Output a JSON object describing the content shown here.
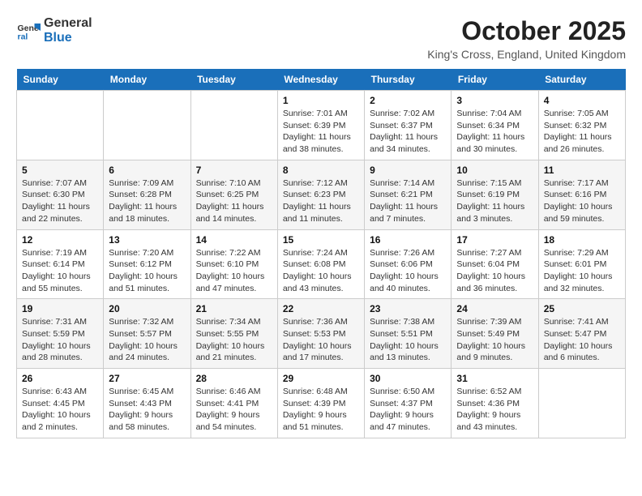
{
  "logo": {
    "line1": "General",
    "line2": "Blue"
  },
  "title": "October 2025",
  "location": "King's Cross, England, United Kingdom",
  "days_of_week": [
    "Sunday",
    "Monday",
    "Tuesday",
    "Wednesday",
    "Thursday",
    "Friday",
    "Saturday"
  ],
  "weeks": [
    [
      {
        "day": "",
        "detail": ""
      },
      {
        "day": "",
        "detail": ""
      },
      {
        "day": "",
        "detail": ""
      },
      {
        "day": "1",
        "detail": "Sunrise: 7:01 AM\nSunset: 6:39 PM\nDaylight: 11 hours\nand 38 minutes."
      },
      {
        "day": "2",
        "detail": "Sunrise: 7:02 AM\nSunset: 6:37 PM\nDaylight: 11 hours\nand 34 minutes."
      },
      {
        "day": "3",
        "detail": "Sunrise: 7:04 AM\nSunset: 6:34 PM\nDaylight: 11 hours\nand 30 minutes."
      },
      {
        "day": "4",
        "detail": "Sunrise: 7:05 AM\nSunset: 6:32 PM\nDaylight: 11 hours\nand 26 minutes."
      }
    ],
    [
      {
        "day": "5",
        "detail": "Sunrise: 7:07 AM\nSunset: 6:30 PM\nDaylight: 11 hours\nand 22 minutes."
      },
      {
        "day": "6",
        "detail": "Sunrise: 7:09 AM\nSunset: 6:28 PM\nDaylight: 11 hours\nand 18 minutes."
      },
      {
        "day": "7",
        "detail": "Sunrise: 7:10 AM\nSunset: 6:25 PM\nDaylight: 11 hours\nand 14 minutes."
      },
      {
        "day": "8",
        "detail": "Sunrise: 7:12 AM\nSunset: 6:23 PM\nDaylight: 11 hours\nand 11 minutes."
      },
      {
        "day": "9",
        "detail": "Sunrise: 7:14 AM\nSunset: 6:21 PM\nDaylight: 11 hours\nand 7 minutes."
      },
      {
        "day": "10",
        "detail": "Sunrise: 7:15 AM\nSunset: 6:19 PM\nDaylight: 11 hours\nand 3 minutes."
      },
      {
        "day": "11",
        "detail": "Sunrise: 7:17 AM\nSunset: 6:16 PM\nDaylight: 10 hours\nand 59 minutes."
      }
    ],
    [
      {
        "day": "12",
        "detail": "Sunrise: 7:19 AM\nSunset: 6:14 PM\nDaylight: 10 hours\nand 55 minutes."
      },
      {
        "day": "13",
        "detail": "Sunrise: 7:20 AM\nSunset: 6:12 PM\nDaylight: 10 hours\nand 51 minutes."
      },
      {
        "day": "14",
        "detail": "Sunrise: 7:22 AM\nSunset: 6:10 PM\nDaylight: 10 hours\nand 47 minutes."
      },
      {
        "day": "15",
        "detail": "Sunrise: 7:24 AM\nSunset: 6:08 PM\nDaylight: 10 hours\nand 43 minutes."
      },
      {
        "day": "16",
        "detail": "Sunrise: 7:26 AM\nSunset: 6:06 PM\nDaylight: 10 hours\nand 40 minutes."
      },
      {
        "day": "17",
        "detail": "Sunrise: 7:27 AM\nSunset: 6:04 PM\nDaylight: 10 hours\nand 36 minutes."
      },
      {
        "day": "18",
        "detail": "Sunrise: 7:29 AM\nSunset: 6:01 PM\nDaylight: 10 hours\nand 32 minutes."
      }
    ],
    [
      {
        "day": "19",
        "detail": "Sunrise: 7:31 AM\nSunset: 5:59 PM\nDaylight: 10 hours\nand 28 minutes."
      },
      {
        "day": "20",
        "detail": "Sunrise: 7:32 AM\nSunset: 5:57 PM\nDaylight: 10 hours\nand 24 minutes."
      },
      {
        "day": "21",
        "detail": "Sunrise: 7:34 AM\nSunset: 5:55 PM\nDaylight: 10 hours\nand 21 minutes."
      },
      {
        "day": "22",
        "detail": "Sunrise: 7:36 AM\nSunset: 5:53 PM\nDaylight: 10 hours\nand 17 minutes."
      },
      {
        "day": "23",
        "detail": "Sunrise: 7:38 AM\nSunset: 5:51 PM\nDaylight: 10 hours\nand 13 minutes."
      },
      {
        "day": "24",
        "detail": "Sunrise: 7:39 AM\nSunset: 5:49 PM\nDaylight: 10 hours\nand 9 minutes."
      },
      {
        "day": "25",
        "detail": "Sunrise: 7:41 AM\nSunset: 5:47 PM\nDaylight: 10 hours\nand 6 minutes."
      }
    ],
    [
      {
        "day": "26",
        "detail": "Sunrise: 6:43 AM\nSunset: 4:45 PM\nDaylight: 10 hours\nand 2 minutes."
      },
      {
        "day": "27",
        "detail": "Sunrise: 6:45 AM\nSunset: 4:43 PM\nDaylight: 9 hours\nand 58 minutes."
      },
      {
        "day": "28",
        "detail": "Sunrise: 6:46 AM\nSunset: 4:41 PM\nDaylight: 9 hours\nand 54 minutes."
      },
      {
        "day": "29",
        "detail": "Sunrise: 6:48 AM\nSunset: 4:39 PM\nDaylight: 9 hours\nand 51 minutes."
      },
      {
        "day": "30",
        "detail": "Sunrise: 6:50 AM\nSunset: 4:37 PM\nDaylight: 9 hours\nand 47 minutes."
      },
      {
        "day": "31",
        "detail": "Sunrise: 6:52 AM\nSunset: 4:36 PM\nDaylight: 9 hours\nand 43 minutes."
      },
      {
        "day": "",
        "detail": ""
      }
    ]
  ]
}
